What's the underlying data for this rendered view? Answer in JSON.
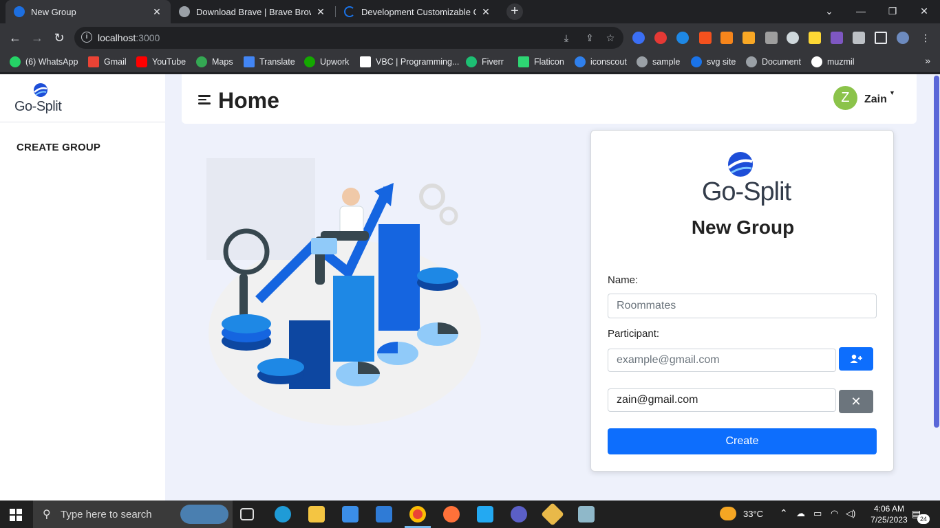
{
  "browser": {
    "tabs": [
      {
        "title": "New Group",
        "active": true
      },
      {
        "title": "Download Brave | Brave Browser",
        "active": false
      },
      {
        "title": "Development Customizable Carto",
        "active": false
      }
    ],
    "new_tab_symbol": "+",
    "url_host": "localhost",
    "url_port": ":3000",
    "bookmarks": [
      {
        "label": "(6) WhatsApp",
        "icon": "whatsapp-icon",
        "color": "#25d366"
      },
      {
        "label": "Gmail",
        "icon": "gmail-icon",
        "color": "#ea4335"
      },
      {
        "label": "YouTube",
        "icon": "youtube-icon",
        "color": "#ff0000"
      },
      {
        "label": "Maps",
        "icon": "maps-icon",
        "color": "#34a853"
      },
      {
        "label": "Translate",
        "icon": "translate-icon",
        "color": "#4285f4"
      },
      {
        "label": "Upwork",
        "icon": "upwork-icon",
        "color": "#14a800"
      },
      {
        "label": "VBC | Programming...",
        "icon": "vbc-icon",
        "color": "#ffffff"
      },
      {
        "label": "Fiverr",
        "icon": "fiverr-icon",
        "color": "#1dbf73"
      },
      {
        "label": "Flaticon",
        "icon": "flaticon-icon",
        "color": "#2ed573"
      },
      {
        "label": "iconscout",
        "icon": "iconscout-icon",
        "color": "#2f80ed"
      },
      {
        "label": "sample",
        "icon": "globe-icon",
        "color": "#9aa0a6"
      },
      {
        "label": "svg site",
        "icon": "svg-icon",
        "color": "#1a73e8"
      },
      {
        "label": "Document",
        "icon": "globe-icon",
        "color": "#9aa0a6"
      },
      {
        "label": "muzmil",
        "icon": "github-icon",
        "color": "#ffffff"
      }
    ],
    "bookmarks_overflow": "»"
  },
  "app": {
    "brand": "Go-Split",
    "sidebar": {
      "items": [
        {
          "label": "CREATE GROUP"
        }
      ]
    },
    "header": {
      "title": "Home",
      "user_initial": "Z",
      "user_name": "Zain"
    },
    "form": {
      "brand": "Go-Split",
      "title": "New Group",
      "name_label": "Name:",
      "name_placeholder": "Roommates",
      "participant_label": "Participant:",
      "participant_placeholder": "example@gmail.com",
      "participants": [
        "zain@gmail.com"
      ],
      "create_label": "Create"
    },
    "colors": {
      "primary": "#0d6efd",
      "secondary": "#6c757d",
      "avatar": "#8bc34a",
      "background": "#eef1fb"
    }
  },
  "taskbar": {
    "search_placeholder": "Type here to search",
    "weather": "33°C",
    "time": "4:06 AM",
    "date": "7/25/2023",
    "notification_count": "24",
    "apps": [
      "task-view-icon",
      "edge-icon",
      "file-explorer-icon",
      "store-icon",
      "mail-icon",
      "chrome-icon",
      "firefox-icon",
      "vscode-icon",
      "app-icon",
      "git-icon",
      "notes-icon"
    ]
  }
}
